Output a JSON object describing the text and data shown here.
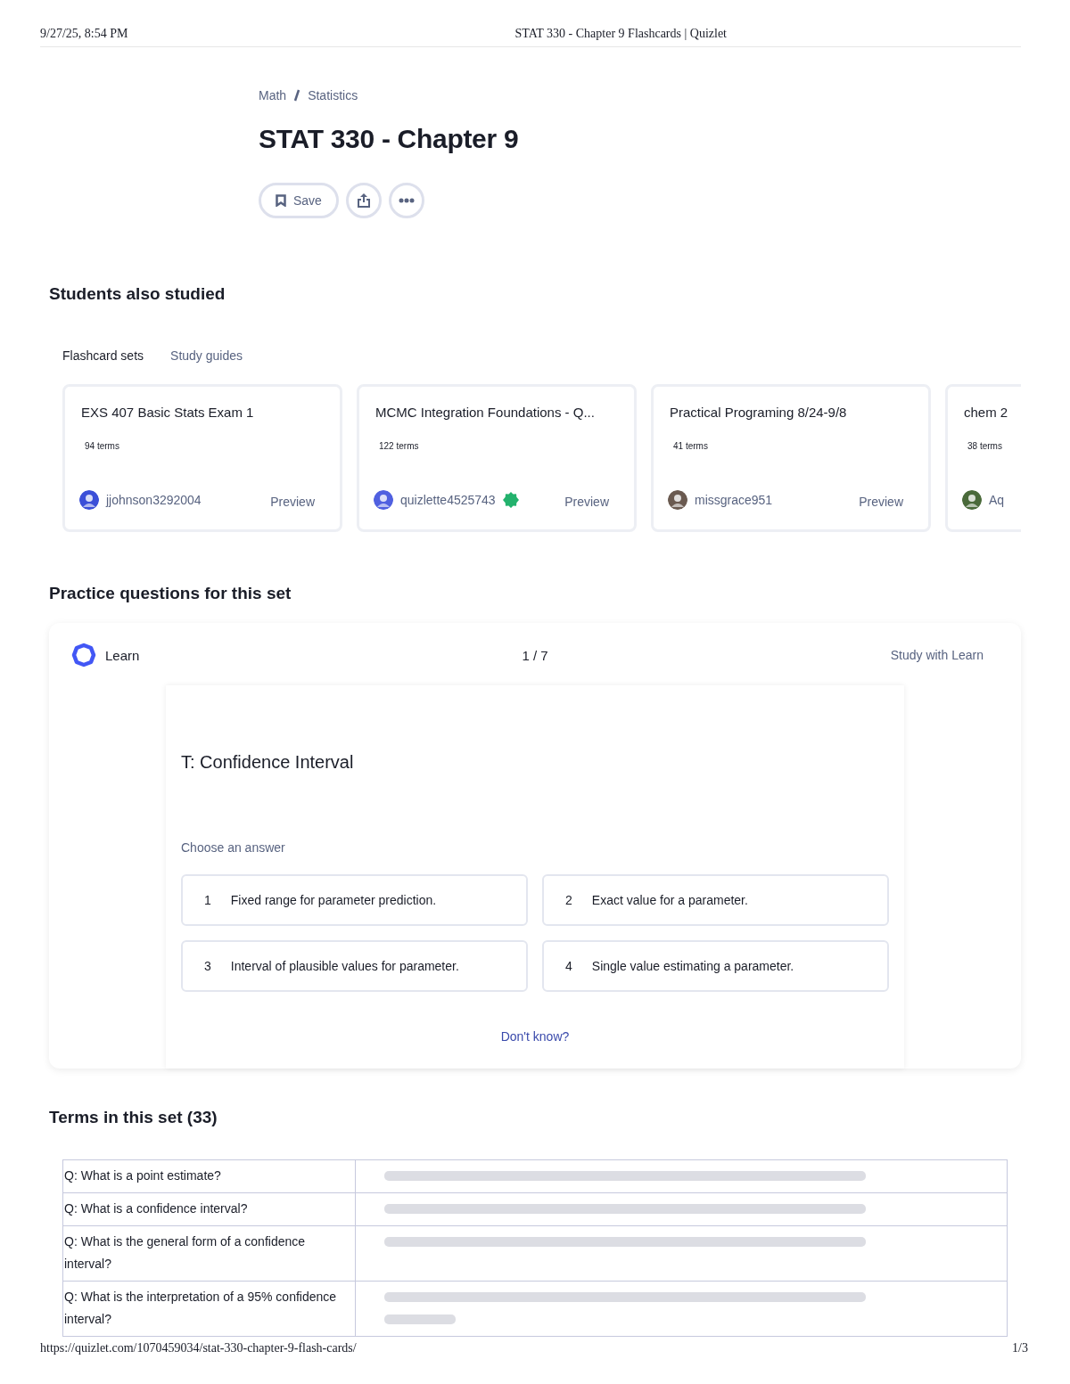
{
  "print_header": {
    "datetime": "9/27/25, 8:54 PM",
    "page_title": "STAT 330 - Chapter 9 Flashcards | Quizlet"
  },
  "breadcrumb": [
    "Math",
    "Statistics"
  ],
  "title": "STAT 330 - Chapter 9",
  "actions": {
    "save_label": "Save"
  },
  "students_also_studied": {
    "heading": "Students also studied",
    "tabs": [
      {
        "label": "Flashcard sets",
        "selected": true
      },
      {
        "label": "Study guides",
        "selected": false
      }
    ],
    "cards": [
      {
        "title": "EXS 407 Basic Stats Exam 1",
        "terms": "94 terms",
        "author": "jjohnson3292004",
        "verified": false,
        "preview": "Preview"
      },
      {
        "title": "MCMC Integration Foundations - Q...",
        "terms": "122 terms",
        "author": "quizlette4525743",
        "verified": true,
        "preview": "Preview"
      },
      {
        "title": "Practical Programing 8/24-9/8",
        "terms": "41 terms",
        "author": "missgrace951",
        "verified": false,
        "preview": "Preview"
      },
      {
        "title": "chem 2",
        "terms": "38 terms",
        "author": "Aq",
        "verified": false
      }
    ]
  },
  "practice": {
    "heading": "Practice questions for this set",
    "mode": "Learn",
    "progress": "1 / 7",
    "study_link": "Study with Learn",
    "question": "T: Confidence Interval",
    "prompt": "Choose an answer",
    "options": [
      {
        "number": "1",
        "text": "Fixed range for parameter prediction."
      },
      {
        "number": "2",
        "text": "Exact value for a parameter."
      },
      {
        "number": "3",
        "text": "Interval of plausible values for parameter."
      },
      {
        "number": "4",
        "text": "Single value estimating a parameter."
      }
    ],
    "dont_know": "Don't know?"
  },
  "terms": {
    "heading": "Terms in this set (33)",
    "rows": [
      {
        "question": "Q: What is a point estimate?"
      },
      {
        "question": "Q: What is a confidence interval?"
      },
      {
        "question": "Q: What is the general form of a confidence interval?"
      },
      {
        "question": "Q: What is the interpretation of a 95% confidence interval?"
      }
    ]
  },
  "print_footer": {
    "url": "https://quizlet.com/1070459034/stat-330-chapter-9-flash-cards/",
    "page": "1/3"
  }
}
